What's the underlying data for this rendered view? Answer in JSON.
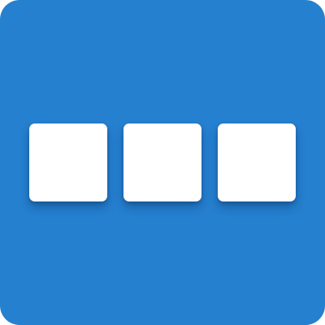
{
  "icon": {
    "name": "three-squares-app-icon",
    "colors": {
      "background": "#2580D0",
      "tile": "#FFFFFF"
    },
    "tiles": [
      {
        "name": "square-icon"
      },
      {
        "name": "square-icon"
      },
      {
        "name": "square-icon"
      }
    ]
  }
}
